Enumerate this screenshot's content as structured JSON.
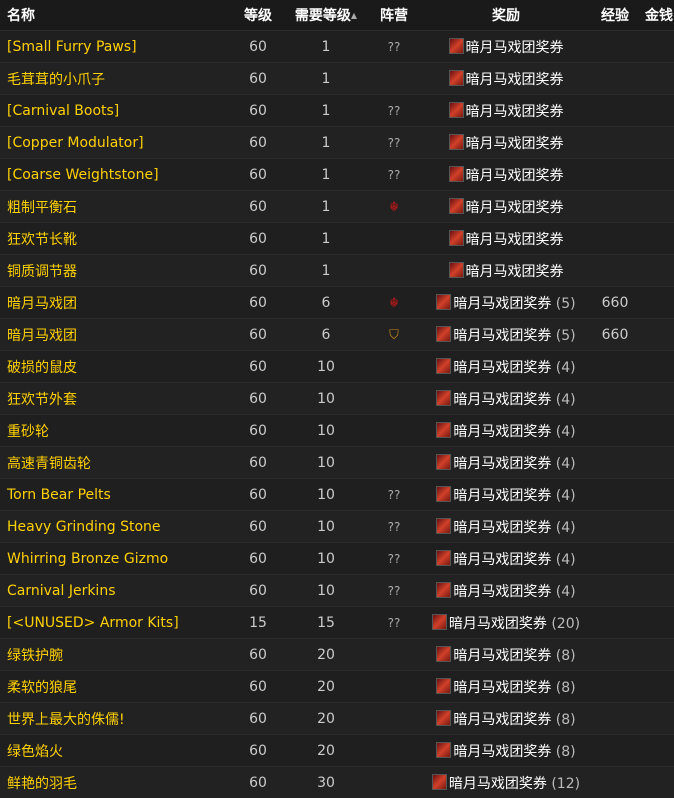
{
  "headers": {
    "name": "名称",
    "level": "等级",
    "req": "需要等级",
    "sort_icon": "sort-ascending",
    "side": "阵营",
    "reward": "奖励",
    "xp": "经验",
    "money": "金钱"
  },
  "colors": {
    "name": "#ffd100",
    "horde": "#c01818",
    "alliance": "#c98a1b"
  },
  "rows": [
    {
      "name": "[Small Furry Paws]",
      "level": "60",
      "req": "1",
      "side": "??",
      "reward": "暗月马戏团奖券",
      "count": "",
      "xp": ""
    },
    {
      "name": "毛茸茸的小爪子",
      "level": "60",
      "req": "1",
      "side": "",
      "reward": "暗月马戏团奖券",
      "count": "",
      "xp": ""
    },
    {
      "name": "[Carnival Boots]",
      "level": "60",
      "req": "1",
      "side": "??",
      "reward": "暗月马戏团奖券",
      "count": "",
      "xp": ""
    },
    {
      "name": "[Copper Modulator]",
      "level": "60",
      "req": "1",
      "side": "??",
      "reward": "暗月马戏团奖券",
      "count": "",
      "xp": ""
    },
    {
      "name": "[Coarse Weightstone]",
      "level": "60",
      "req": "1",
      "side": "??",
      "reward": "暗月马戏团奖券",
      "count": "",
      "xp": ""
    },
    {
      "name": "粗制平衡石",
      "level": "60",
      "req": "1",
      "side": "horde",
      "reward": "暗月马戏团奖券",
      "count": "",
      "xp": ""
    },
    {
      "name": "狂欢节长靴",
      "level": "60",
      "req": "1",
      "side": "",
      "reward": "暗月马戏团奖券",
      "count": "",
      "xp": ""
    },
    {
      "name": "铜质调节器",
      "level": "60",
      "req": "1",
      "side": "",
      "reward": "暗月马戏团奖券",
      "count": "",
      "xp": ""
    },
    {
      "name": "暗月马戏团",
      "level": "60",
      "req": "6",
      "side": "horde",
      "reward": "暗月马戏团奖券",
      "count": "(5)",
      "xp": "660"
    },
    {
      "name": "暗月马戏团",
      "level": "60",
      "req": "6",
      "side": "alliance",
      "reward": "暗月马戏团奖券",
      "count": "(5)",
      "xp": "660"
    },
    {
      "name": "破损的鼠皮",
      "level": "60",
      "req": "10",
      "side": "",
      "reward": "暗月马戏团奖券",
      "count": "(4)",
      "xp": ""
    },
    {
      "name": "狂欢节外套",
      "level": "60",
      "req": "10",
      "side": "",
      "reward": "暗月马戏团奖券",
      "count": "(4)",
      "xp": ""
    },
    {
      "name": "重砂轮",
      "level": "60",
      "req": "10",
      "side": "",
      "reward": "暗月马戏团奖券",
      "count": "(4)",
      "xp": ""
    },
    {
      "name": "高速青铜齿轮",
      "level": "60",
      "req": "10",
      "side": "",
      "reward": "暗月马戏团奖券",
      "count": "(4)",
      "xp": ""
    },
    {
      "name": "Torn Bear Pelts",
      "level": "60",
      "req": "10",
      "side": "??",
      "reward": "暗月马戏团奖券",
      "count": "(4)",
      "xp": ""
    },
    {
      "name": "Heavy Grinding Stone",
      "level": "60",
      "req": "10",
      "side": "??",
      "reward": "暗月马戏团奖券",
      "count": "(4)",
      "xp": ""
    },
    {
      "name": "Whirring Bronze Gizmo",
      "level": "60",
      "req": "10",
      "side": "??",
      "reward": "暗月马戏团奖券",
      "count": "(4)",
      "xp": ""
    },
    {
      "name": "Carnival Jerkins",
      "level": "60",
      "req": "10",
      "side": "??",
      "reward": "暗月马戏团奖券",
      "count": "(4)",
      "xp": ""
    },
    {
      "name": "[<UNUSED> Armor Kits]",
      "level": "15",
      "req": "15",
      "side": "??",
      "reward": "暗月马戏团奖券",
      "count": "(20)",
      "xp": ""
    },
    {
      "name": "绿铁护腕",
      "level": "60",
      "req": "20",
      "side": "",
      "reward": "暗月马戏团奖券",
      "count": "(8)",
      "xp": ""
    },
    {
      "name": "柔软的狼尾",
      "level": "60",
      "req": "20",
      "side": "",
      "reward": "暗月马戏团奖券",
      "count": "(8)",
      "xp": ""
    },
    {
      "name": "世界上最大的侏儒!",
      "level": "60",
      "req": "20",
      "side": "",
      "reward": "暗月马戏团奖券",
      "count": "(8)",
      "xp": ""
    },
    {
      "name": "绿色焰火",
      "level": "60",
      "req": "20",
      "side": "",
      "reward": "暗月马戏团奖券",
      "count": "(8)",
      "xp": ""
    },
    {
      "name": "鲜艳的羽毛",
      "level": "60",
      "req": "30",
      "side": "",
      "reward": "暗月马戏团奖券",
      "count": "(12)",
      "xp": ""
    }
  ]
}
